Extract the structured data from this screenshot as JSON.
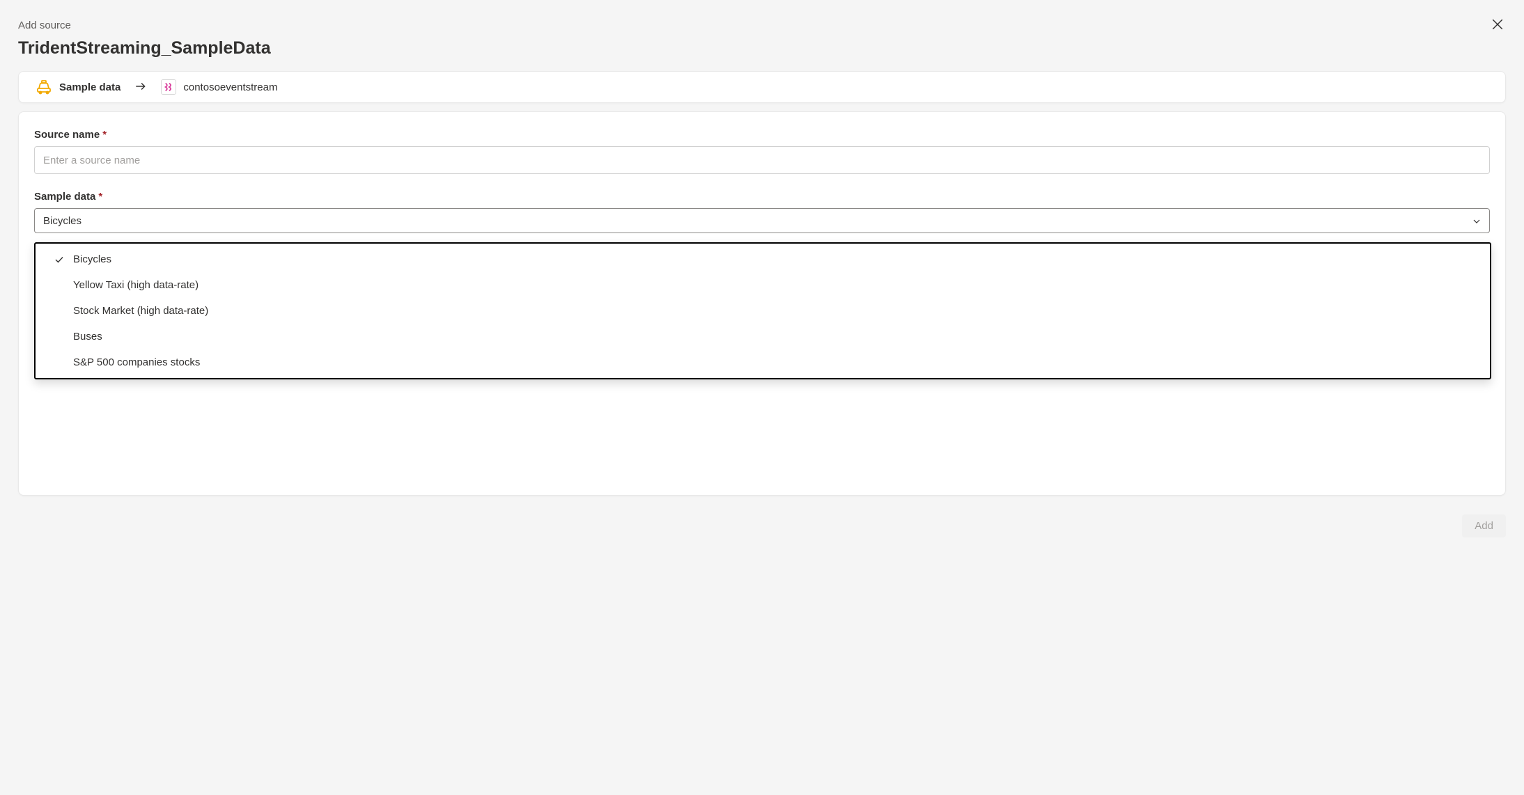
{
  "dialog": {
    "label": "Add source",
    "title": "TridentStreaming_SampleData"
  },
  "breadcrumb": {
    "source_label": "Sample data",
    "destination_label": "contosoeventstream"
  },
  "form": {
    "source_name": {
      "label": "Source name",
      "placeholder": "Enter a source name",
      "value": ""
    },
    "sample_data": {
      "label": "Sample data",
      "selected": "Bicycles",
      "options": [
        {
          "label": "Bicycles",
          "selected": true
        },
        {
          "label": "Yellow Taxi (high data-rate)",
          "selected": false
        },
        {
          "label": "Stock Market (high data-rate)",
          "selected": false
        },
        {
          "label": "Buses",
          "selected": false
        },
        {
          "label": "S&P 500 companies stocks",
          "selected": false
        }
      ]
    }
  },
  "footer": {
    "add_label": "Add"
  }
}
